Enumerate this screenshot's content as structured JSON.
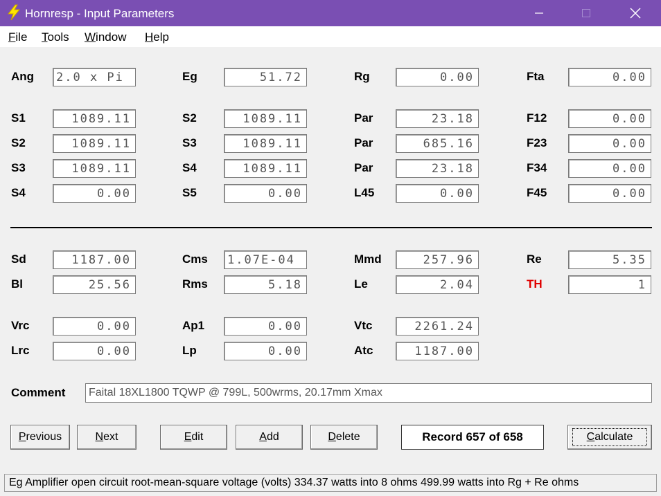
{
  "window": {
    "title": "Hornresp - Input Parameters",
    "accent": "#7a4fb3",
    "minimize_icon": "minimize-icon",
    "maximize_icon": "maximize-icon",
    "close_icon": "close-icon"
  },
  "menu": [
    {
      "label": "File",
      "mnemonic": "F",
      "rest": "ile"
    },
    {
      "label": "Tools",
      "mnemonic": "T",
      "rest": "ools"
    },
    {
      "label": "Window",
      "mnemonic": "W",
      "rest": "indow"
    },
    {
      "label": "Help",
      "mnemonic": "H",
      "rest": "elp"
    }
  ],
  "params": {
    "ang": {
      "label": "Ang",
      "value": "2.0 x Pi"
    },
    "eg": {
      "label": "Eg",
      "value": "51.72"
    },
    "rg": {
      "label": "Rg",
      "value": "0.00"
    },
    "fta": {
      "label": "Fta",
      "value": "0.00"
    },
    "s1a": {
      "label": "S1",
      "value": "1089.11"
    },
    "s2a": {
      "label": "S2",
      "value": "1089.11"
    },
    "par1": {
      "label": "Par",
      "value": "23.18"
    },
    "f12": {
      "label": "F12",
      "value": "0.00"
    },
    "s2b": {
      "label": "S2",
      "value": "1089.11"
    },
    "s3b": {
      "label": "S3",
      "value": "1089.11"
    },
    "par2": {
      "label": "Par",
      "value": "685.16"
    },
    "f23": {
      "label": "F23",
      "value": "0.00"
    },
    "s3c": {
      "label": "S3",
      "value": "1089.11"
    },
    "s4c": {
      "label": "S4",
      "value": "1089.11"
    },
    "par3": {
      "label": "Par",
      "value": "23.18"
    },
    "f34": {
      "label": "F34",
      "value": "0.00"
    },
    "s4d": {
      "label": "S4",
      "value": "0.00"
    },
    "s5d": {
      "label": "S5",
      "value": "0.00"
    },
    "l45": {
      "label": "L45",
      "value": "0.00"
    },
    "f45": {
      "label": "F45",
      "value": "0.00"
    },
    "sd": {
      "label": "Sd",
      "value": "1187.00"
    },
    "cms": {
      "label": "Cms",
      "value": "1.07E-04"
    },
    "mmd": {
      "label": "Mmd",
      "value": "257.96"
    },
    "re": {
      "label": "Re",
      "value": "5.35"
    },
    "bl": {
      "label": "Bl",
      "value": "25.56"
    },
    "rms": {
      "label": "Rms",
      "value": "5.18"
    },
    "le": {
      "label": "Le",
      "value": "2.04"
    },
    "th": {
      "label": "TH",
      "value": "1"
    },
    "vrc": {
      "label": "Vrc",
      "value": "0.00"
    },
    "ap1": {
      "label": "Ap1",
      "value": "0.00"
    },
    "vtc": {
      "label": "Vtc",
      "value": "2261.24"
    },
    "lrc": {
      "label": "Lrc",
      "value": "0.00"
    },
    "lp": {
      "label": "Lp",
      "value": "0.00"
    },
    "atc": {
      "label": "Atc",
      "value": "1187.00"
    }
  },
  "comment": {
    "label": "Comment",
    "value": "Faital 18XL1800 TQWP @ 799L, 500wrms, 20.17mm Xmax"
  },
  "buttons": {
    "previous": {
      "mnemonic": "P",
      "rest": "revious"
    },
    "next": {
      "mnemonic": "N",
      "rest": "ext"
    },
    "edit": {
      "mnemonic": "E",
      "rest": "dit"
    },
    "add": {
      "mnemonic": "A",
      "rest": "dd"
    },
    "delete": {
      "mnemonic": "D",
      "rest": "elete"
    },
    "calculate": {
      "mnemonic": "C",
      "rest": "alculate"
    }
  },
  "record": "Record 657 of 658",
  "status": "Eg  Amplifier open circuit root-mean-square voltage  (volts)   334.37 watts into 8 ohms    499.99 watts into Rg + Re ohms"
}
